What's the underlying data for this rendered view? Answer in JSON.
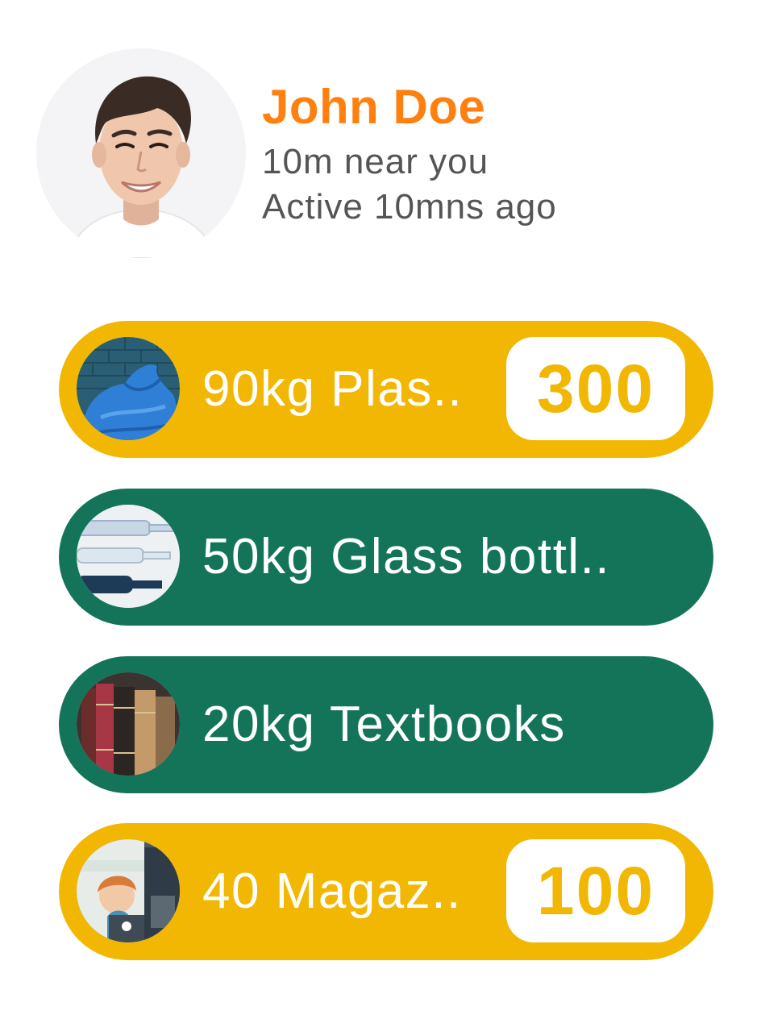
{
  "profile": {
    "name": "John Doe",
    "distance": "10m near you",
    "activity": "Active 10mns ago"
  },
  "items": [
    {
      "label": "90kg Plas..",
      "points": "300",
      "color": "#f1b702",
      "thumb": "plastic-bag"
    },
    {
      "label": "50kg Glass bottl..",
      "points": "",
      "color": "#13745a",
      "thumb": "glass-bottles"
    },
    {
      "label": "20kg Textbooks",
      "points": "",
      "color": "#13745a",
      "thumb": "textbooks"
    },
    {
      "label": "40 Magaz..",
      "points": "100",
      "color": "#f1b702",
      "thumb": "magazines"
    }
  ],
  "colors": {
    "accent_orange": "#ff7f0f",
    "yellow": "#f1b702",
    "green": "#13745a",
    "meta_gray": "#555555"
  }
}
